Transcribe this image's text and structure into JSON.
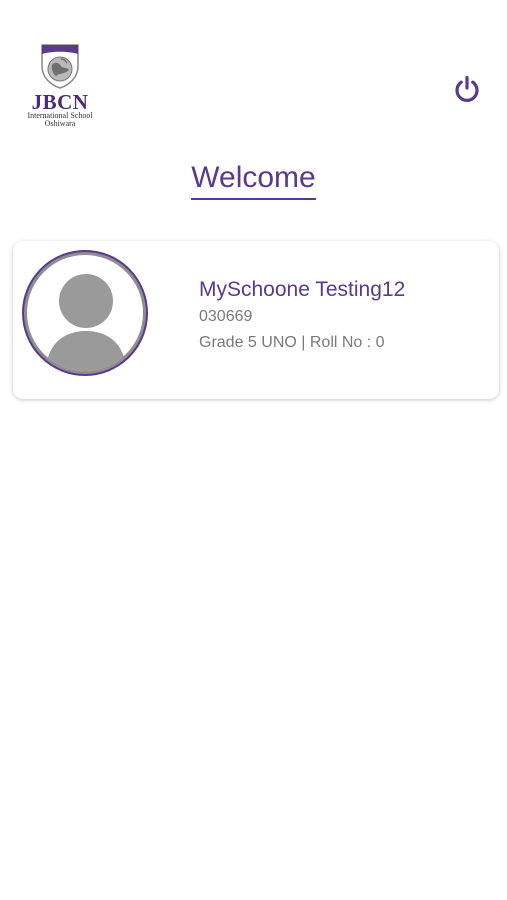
{
  "header": {
    "logo": {
      "name": "JBCN",
      "subtitle_line1": "International School",
      "subtitle_line2": "Oshiwara"
    },
    "power_icon": "power-icon"
  },
  "welcome": {
    "title": "Welcome"
  },
  "student_card": {
    "name": "MySchoone Testing12",
    "id": "030669",
    "grade_roll": "Grade 5 UNO | Roll No : 0",
    "avatar_icon": "person-placeholder-icon"
  },
  "colors": {
    "brand_purple": "#5a3a8c",
    "logo_purple": "#4b2a7b",
    "secondary_text": "#7a7a7a",
    "avatar_gray": "#8e8e8e"
  }
}
